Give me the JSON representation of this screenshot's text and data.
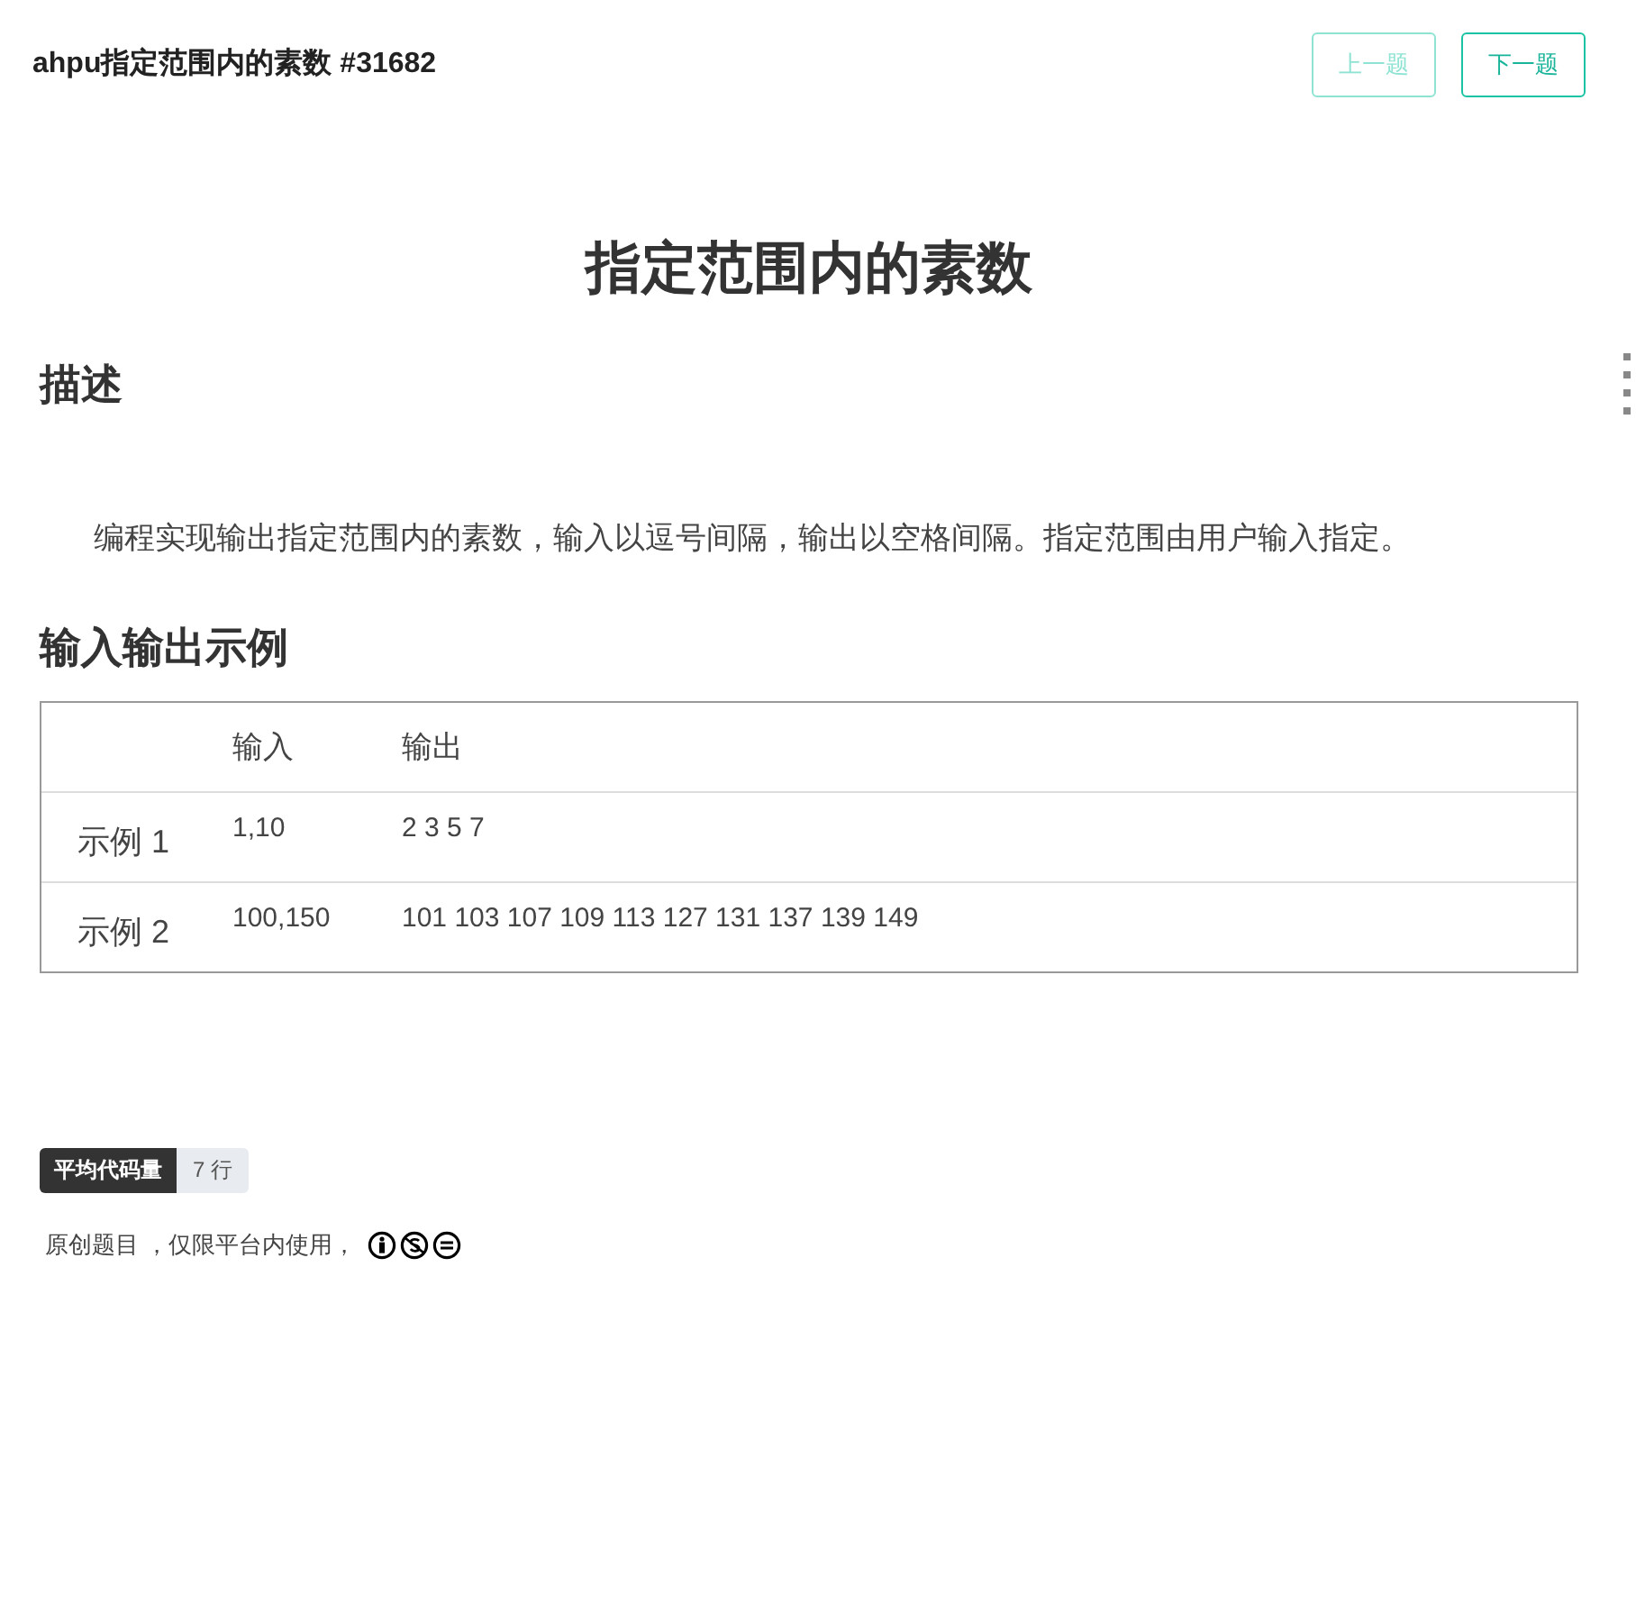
{
  "header": {
    "title": "ahpu指定范围内的素数 #31682",
    "buttons": [
      {
        "label": "上一题",
        "disabled": true
      },
      {
        "label": "下一题",
        "disabled": false
      }
    ]
  },
  "problem_title": "指定范围内的素数",
  "sections": [
    {
      "heading": "描述",
      "kind": "text",
      "text": "编程实现输出指定范围内的素数，输入以逗号间隔，输出以空格间隔。指定范围由用户输入指定。"
    },
    {
      "heading": "输入输出示例",
      "kind": "table",
      "columns": [
        "输入",
        "输出"
      ],
      "rows": [
        {
          "label": "示例 1",
          "input": "1,10",
          "output": "2 3 5 7"
        },
        {
          "label": "示例 2",
          "input": "100,150",
          "output": "101 103 107 109 113 127 131 137 139 149"
        }
      ]
    }
  ],
  "stat": {
    "label": "平均代码量",
    "value": "7 行"
  },
  "license": "原创题目 ，仅限平台内使用，"
}
